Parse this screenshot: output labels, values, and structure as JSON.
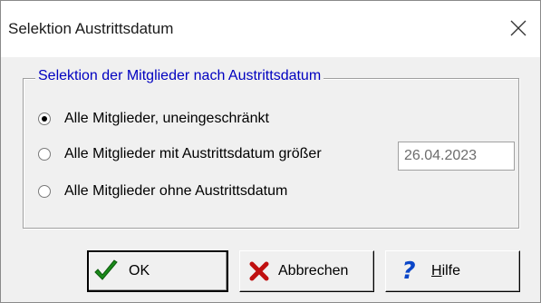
{
  "window": {
    "title": "Selektion Austrittsdatum"
  },
  "group": {
    "legend": "Selektion der Mitglieder nach Austrittsdatum",
    "options": [
      {
        "label": "Alle Mitglieder, uneingeschränkt",
        "checked": true
      },
      {
        "label": "Alle Mitglieder mit Austrittsdatum größer",
        "checked": false
      },
      {
        "label": "Alle Mitglieder ohne Austrittsdatum",
        "checked": false
      }
    ],
    "date_value": "26.04.2023"
  },
  "buttons": {
    "ok_label": "OK",
    "cancel_label": "Abbrechen",
    "help_label": "Hilfe"
  },
  "icons": {
    "close": "close-icon",
    "ok": "checkmark-icon",
    "cancel": "x-cross-icon",
    "help": "question-mark-icon"
  },
  "colors": {
    "legend_text": "#0000c0",
    "checkmark": "#1a8a1a",
    "cross": "#c01010",
    "help": "#0a46c8"
  }
}
